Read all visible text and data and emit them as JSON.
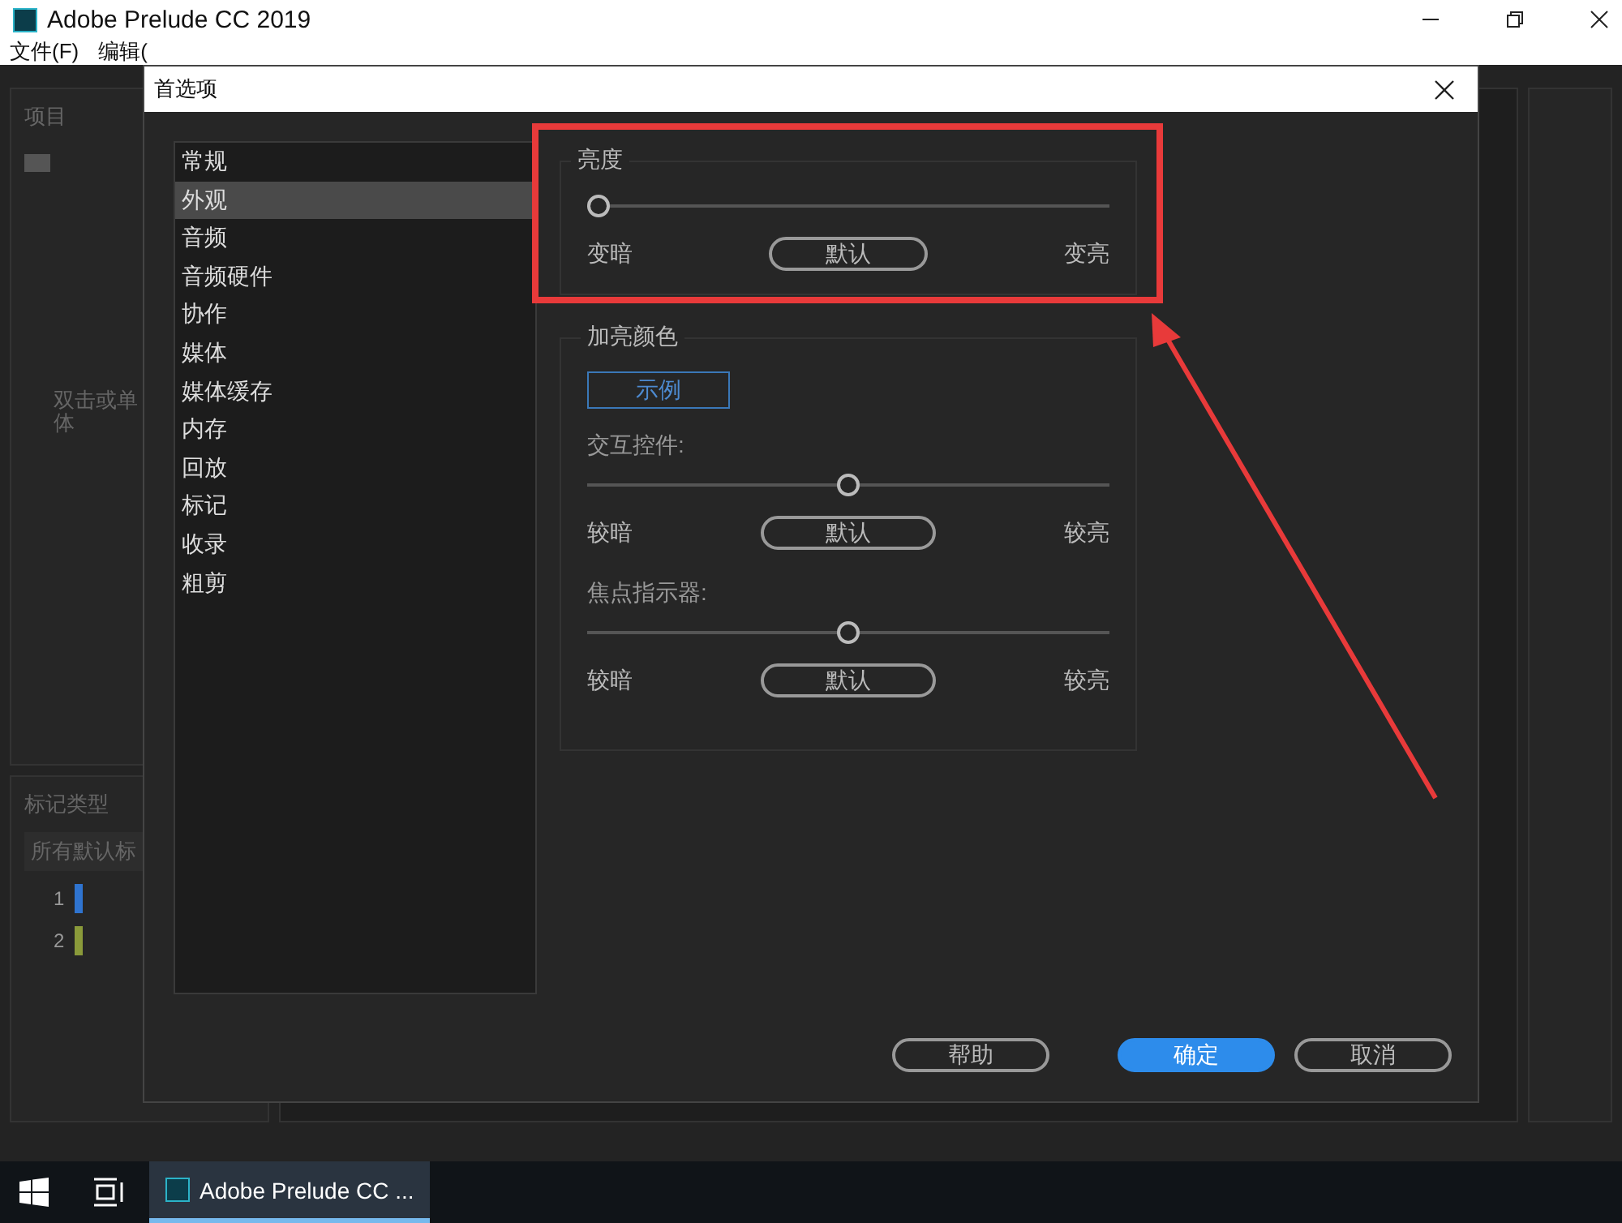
{
  "window": {
    "title": "Adobe Prelude CC 2019"
  },
  "menu": [
    "文件(F)",
    "编辑("
  ],
  "background_panels": {
    "project": {
      "title": "项目",
      "hint_lines": [
        "双击或单",
        "体"
      ]
    },
    "marker_types": {
      "title": "标记类型",
      "filter": "所有默认标",
      "items": [
        {
          "number": "1",
          "color": "#2f74d0"
        },
        {
          "number": "2",
          "color": "#8a9a3a"
        }
      ]
    }
  },
  "dialog": {
    "title": "首选项",
    "categories": [
      {
        "label": "常规",
        "selected": false
      },
      {
        "label": "外观",
        "selected": true
      },
      {
        "label": "音频",
        "selected": false
      },
      {
        "label": "音频硬件",
        "selected": false
      },
      {
        "label": "协作",
        "selected": false
      },
      {
        "label": "媒体",
        "selected": false
      },
      {
        "label": "媒体缓存",
        "selected": false
      },
      {
        "label": "内存",
        "selected": false
      },
      {
        "label": "回放",
        "selected": false
      },
      {
        "label": "标记",
        "selected": false
      },
      {
        "label": "收录",
        "selected": false
      },
      {
        "label": "粗剪",
        "selected": false
      }
    ],
    "brightness": {
      "title": "亮度",
      "level": 0,
      "left": "变暗",
      "button": "默认",
      "right": "变亮"
    },
    "highlight": {
      "title": "加亮颜色",
      "sample": "示例",
      "sliders": [
        {
          "label": "交互控件:",
          "level": 0.5,
          "left": "较暗",
          "button": "默认",
          "right": "较亮"
        },
        {
          "label": "焦点指示器:",
          "level": 0.5,
          "left": "较暗",
          "button": "默认",
          "right": "较亮"
        }
      ]
    },
    "buttons": [
      {
        "label": "帮助",
        "kind": "secondary"
      },
      {
        "label": "确定",
        "kind": "primary"
      },
      {
        "label": "取消",
        "kind": "secondary"
      }
    ]
  },
  "taskbar": {
    "app": "Adobe Prelude CC ...",
    "selected": true
  }
}
